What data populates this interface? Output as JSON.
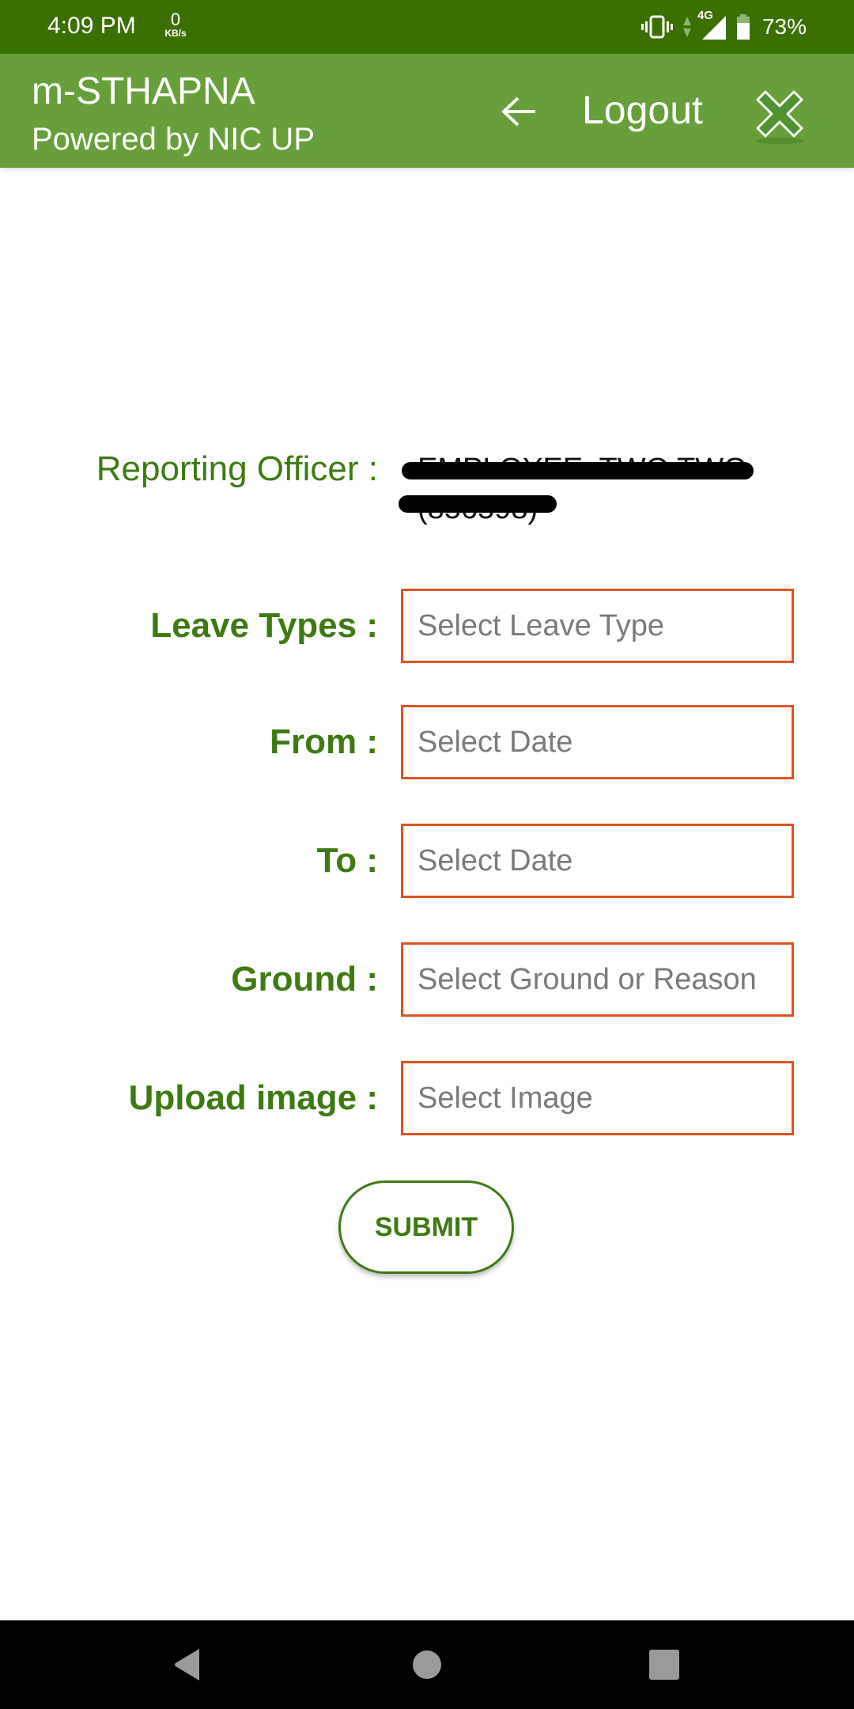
{
  "status_bar": {
    "time": "4:09 PM",
    "net_speed_value": "0",
    "net_speed_unit": "KB/s",
    "network_type": "4G",
    "battery_percent": "73%",
    "icons": [
      "vibrate-icon",
      "data-activity-icon",
      "signal-icon",
      "battery-icon"
    ]
  },
  "app_bar": {
    "title": "m-STHAPNA",
    "subtitle": "Powered by NIC UP",
    "back_icon": "arrow-left-icon",
    "logout_label": "Logout",
    "close_icon": "close-x-icon"
  },
  "reporting_officer": {
    "label": "Reporting Officer :",
    "value_line1": "EMPLOYEE  TWO TWO",
    "value_line2": "(856598)",
    "redacted": true
  },
  "form": {
    "fields": [
      {
        "label": "Leave Types :",
        "placeholder": "Select Leave Type"
      },
      {
        "label": "From :",
        "placeholder": "Select Date"
      },
      {
        "label": "To :",
        "placeholder": "Select Date"
      },
      {
        "label": "Ground :",
        "placeholder": "Select Ground or Reason"
      },
      {
        "label": "Upload image :",
        "placeholder": "Select Image"
      }
    ],
    "submit_label": "SUBMIT"
  },
  "nav_bar": {
    "buttons": [
      "back-triangle-icon",
      "home-circle-icon",
      "recents-square-icon"
    ]
  },
  "colors": {
    "status_bar": "#3b7000",
    "app_bar": "#67a03a",
    "label_green": "#3d7a12",
    "field_border": "#e0531f",
    "placeholder": "#7a7a7a"
  }
}
